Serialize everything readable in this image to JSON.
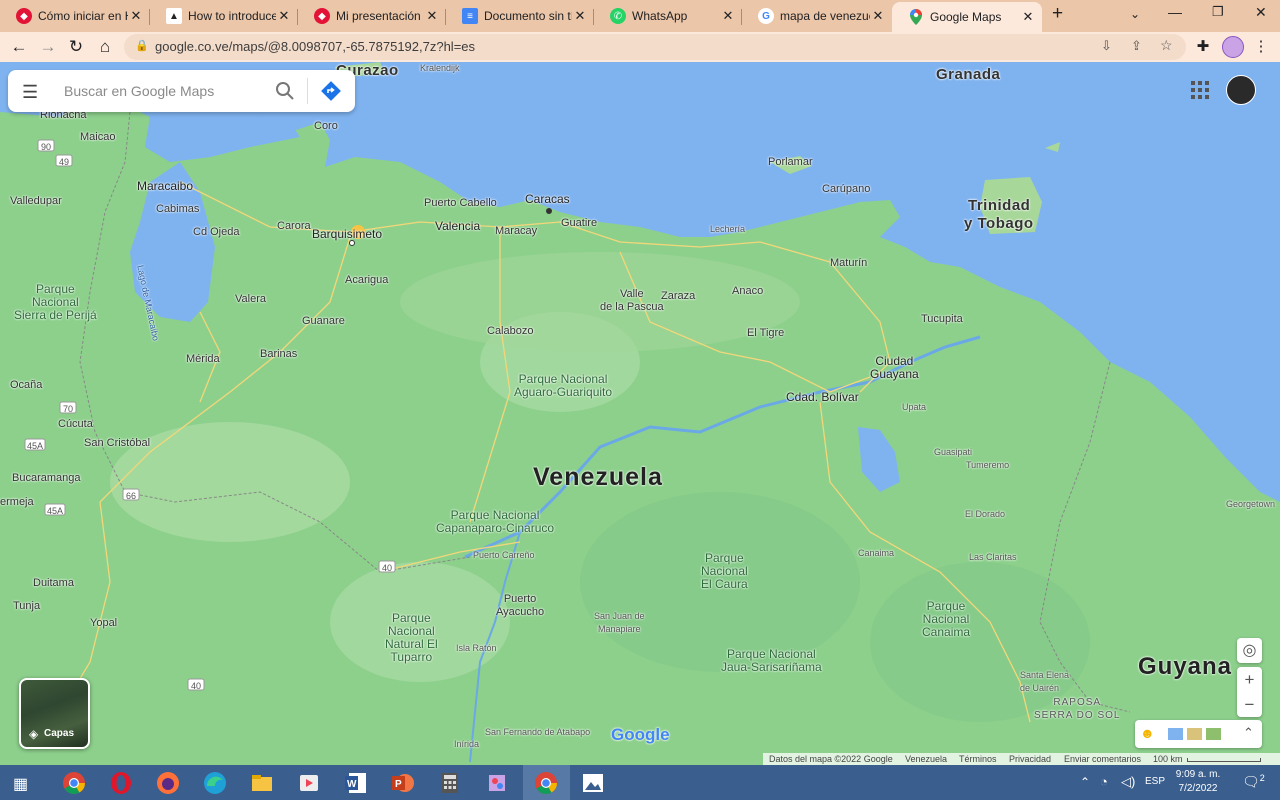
{
  "browser": {
    "tabs": [
      {
        "title": "Cómo iniciar en HI",
        "icon": "hive-icon",
        "color": "#e31337"
      },
      {
        "title": "How to introducey",
        "icon": "ecency-icon",
        "color": "#222222"
      },
      {
        "title": "Mi presentación en",
        "icon": "hive-icon",
        "color": "#e31337"
      },
      {
        "title": "Documento sin títu",
        "icon": "google-docs-icon",
        "color": "#4285f4"
      },
      {
        "title": "WhatsApp",
        "icon": "whatsapp-icon",
        "color": "#25d366"
      },
      {
        "title": "mapa de venezuela",
        "icon": "google-search-icon",
        "color": "#4285f4"
      },
      {
        "title": "Google Maps",
        "icon": "google-maps-pin-icon",
        "color": "#34a853"
      }
    ],
    "new_tab": "+",
    "url": "google.co.ve/maps/@8.0098707,-65.7875192,7z?hl=es"
  },
  "maps": {
    "search_placeholder": "Buscar en Google Maps",
    "layers_label": "Capas",
    "country_label": "Venezuela",
    "logo": "Google",
    "footer": {
      "data": "Datos del mapa ©2022 Google",
      "region": "Venezuela",
      "terms": "Términos",
      "privacy": "Privacidad",
      "feedback": "Enviar comentarios",
      "scale": "100 km"
    },
    "labels": {
      "curazao": "Curazao",
      "granada": "Granada",
      "kralendijk": "Kralendijk",
      "riohacha": "Riohacha",
      "maicao": "Maicao",
      "coro": "Coro",
      "porlamar": "Porlamar",
      "carupano": "Carúpano",
      "trinidad1": "Trinidad",
      "trinidad2": "y Tobago",
      "maracaibo": "Maracaibo",
      "cabimas": "Cabimas",
      "valledupar": "Valledupar",
      "puerto_cabello": "Puerto Cabello",
      "caracas": "Caracas",
      "carora": "Carora",
      "cdojeda": "Cd Ojeda",
      "barquisimeto": "Barquisimeto",
      "valencia": "Valencia",
      "maracay": "Maracay",
      "guatire": "Guatire",
      "lecheria": "Lechería",
      "maturin": "Maturín",
      "lago": "Lago de Maracaibo",
      "acarigua": "Acarigua",
      "valle": "Valle\nde la Pascua",
      "zaraza": "Zaraza",
      "anaco": "Anaco",
      "perija": "Parque\nNacional\nSierra de Perijá",
      "valera": "Valera",
      "guanare": "Guanare",
      "calabozo": "Calabozo",
      "tucupita": "Tucupita",
      "eltigre": "El Tigre",
      "merida": "Mérida",
      "barinas": "Barinas",
      "ciudad_guayana": "Ciudad\nGuayana",
      "ocana": "Ocaña",
      "aguaro": "Parque Nacional\nAguaro-Guariquito",
      "cdbolivar": "Cdad. Bolívar",
      "upata": "Upata",
      "cucuta": "Cúcuta",
      "sancristobal": "San Cristóbal",
      "guasipati": "Guasipati",
      "tumeremo": "Tumeremo",
      "bucaramanga": "Bucaramanga",
      "barrancabermeja": "ermeja",
      "georgetown": "Georgetown",
      "capanaparo": "Parque Nacional\nCapanaparo-Cinaruco",
      "eldorado": "El Dorado",
      "puerto_carreno": "Puerto Carreño",
      "caura": "Parque\nNacional\nEl Caura",
      "canaima_town": "Canaima",
      "lasclaritas": "Las Claritas",
      "duitama": "Duitama",
      "puerto_ayacucho": "Puerto\nAyacucho",
      "tunja": "Tunja",
      "yopal": "Yopal",
      "tuparro": "Parque\nNacional\nNatural El\nTuparro",
      "sanjuan": "San Juan de\nManapiare",
      "canaima": "Parque\nNacional\nCanaima",
      "islaraton": "Isla Ratón",
      "jaua": "Parque Nacional\nJaua-Sarisariñama",
      "santaelena": "Santa Elena\nde Uairén",
      "guyana": "Guyana",
      "raposa": "RAPOSA\nSERRA DO SOL",
      "inirida": "Inírida",
      "sanfernando": "San Fernando de Atabapo",
      "r90": "90",
      "r49": "49",
      "r70": "70",
      "r45a": "45A",
      "r45a2": "45A",
      "r66": "66",
      "r40": "40",
      "r40b": "40"
    }
  },
  "taskbar": {
    "time": "9:09 a. m.",
    "date": "7/2/2022",
    "lang": "ESP",
    "notifications": "2"
  }
}
